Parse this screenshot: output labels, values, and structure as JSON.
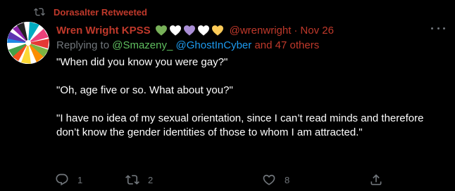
{
  "colors": {
    "background": "#000000",
    "retweet_accent": "#c0392b",
    "muted": "#71767b",
    "mention_blue": "#1d9bf0",
    "mention_green": "#5fbf5f",
    "body_text": "#ffffff"
  },
  "retweet": {
    "icon": "retweet-icon",
    "label": "Dorasalter Retweeted"
  },
  "author": {
    "avatar_icon": "rainbow-swirl-avatar",
    "display_name": "Wren Wright KPSS",
    "hearts": [
      {
        "icon": "green-heart-icon",
        "color": "#78b159"
      },
      {
        "icon": "white-heart-icon",
        "color": "#ffffff"
      },
      {
        "icon": "purple-heart-icon",
        "color": "#aa8ed6"
      },
      {
        "icon": "white-heart-icon",
        "color": "#ffffff"
      },
      {
        "icon": "yellow-heart-icon",
        "color": "#fdcb58"
      }
    ],
    "handle": "@wrenwright",
    "separator": "·",
    "timestamp": "Nov 26"
  },
  "reply": {
    "prefix": "Replying to ",
    "mention_1": "@Smazeny_",
    "mention_2": "@GhostInCyber",
    "others": "and 47 others"
  },
  "body": {
    "paragraphs": [
      "\"When did you know you were gay?\"",
      "\"Oh, age five or so. What about you?\"",
      "\"I have no idea of my sexual orientation, since I can’t read minds and therefore don’t know the gender identities of those to whom I am attracted.\""
    ]
  },
  "actions": {
    "reply": {
      "icon": "reply-icon",
      "count": "1"
    },
    "retweet": {
      "icon": "retweet-icon",
      "count": "2"
    },
    "like": {
      "icon": "heart-outline-icon",
      "count": "8"
    },
    "share": {
      "icon": "share-icon"
    }
  },
  "more_menu": {
    "icon": "more-options-icon"
  }
}
